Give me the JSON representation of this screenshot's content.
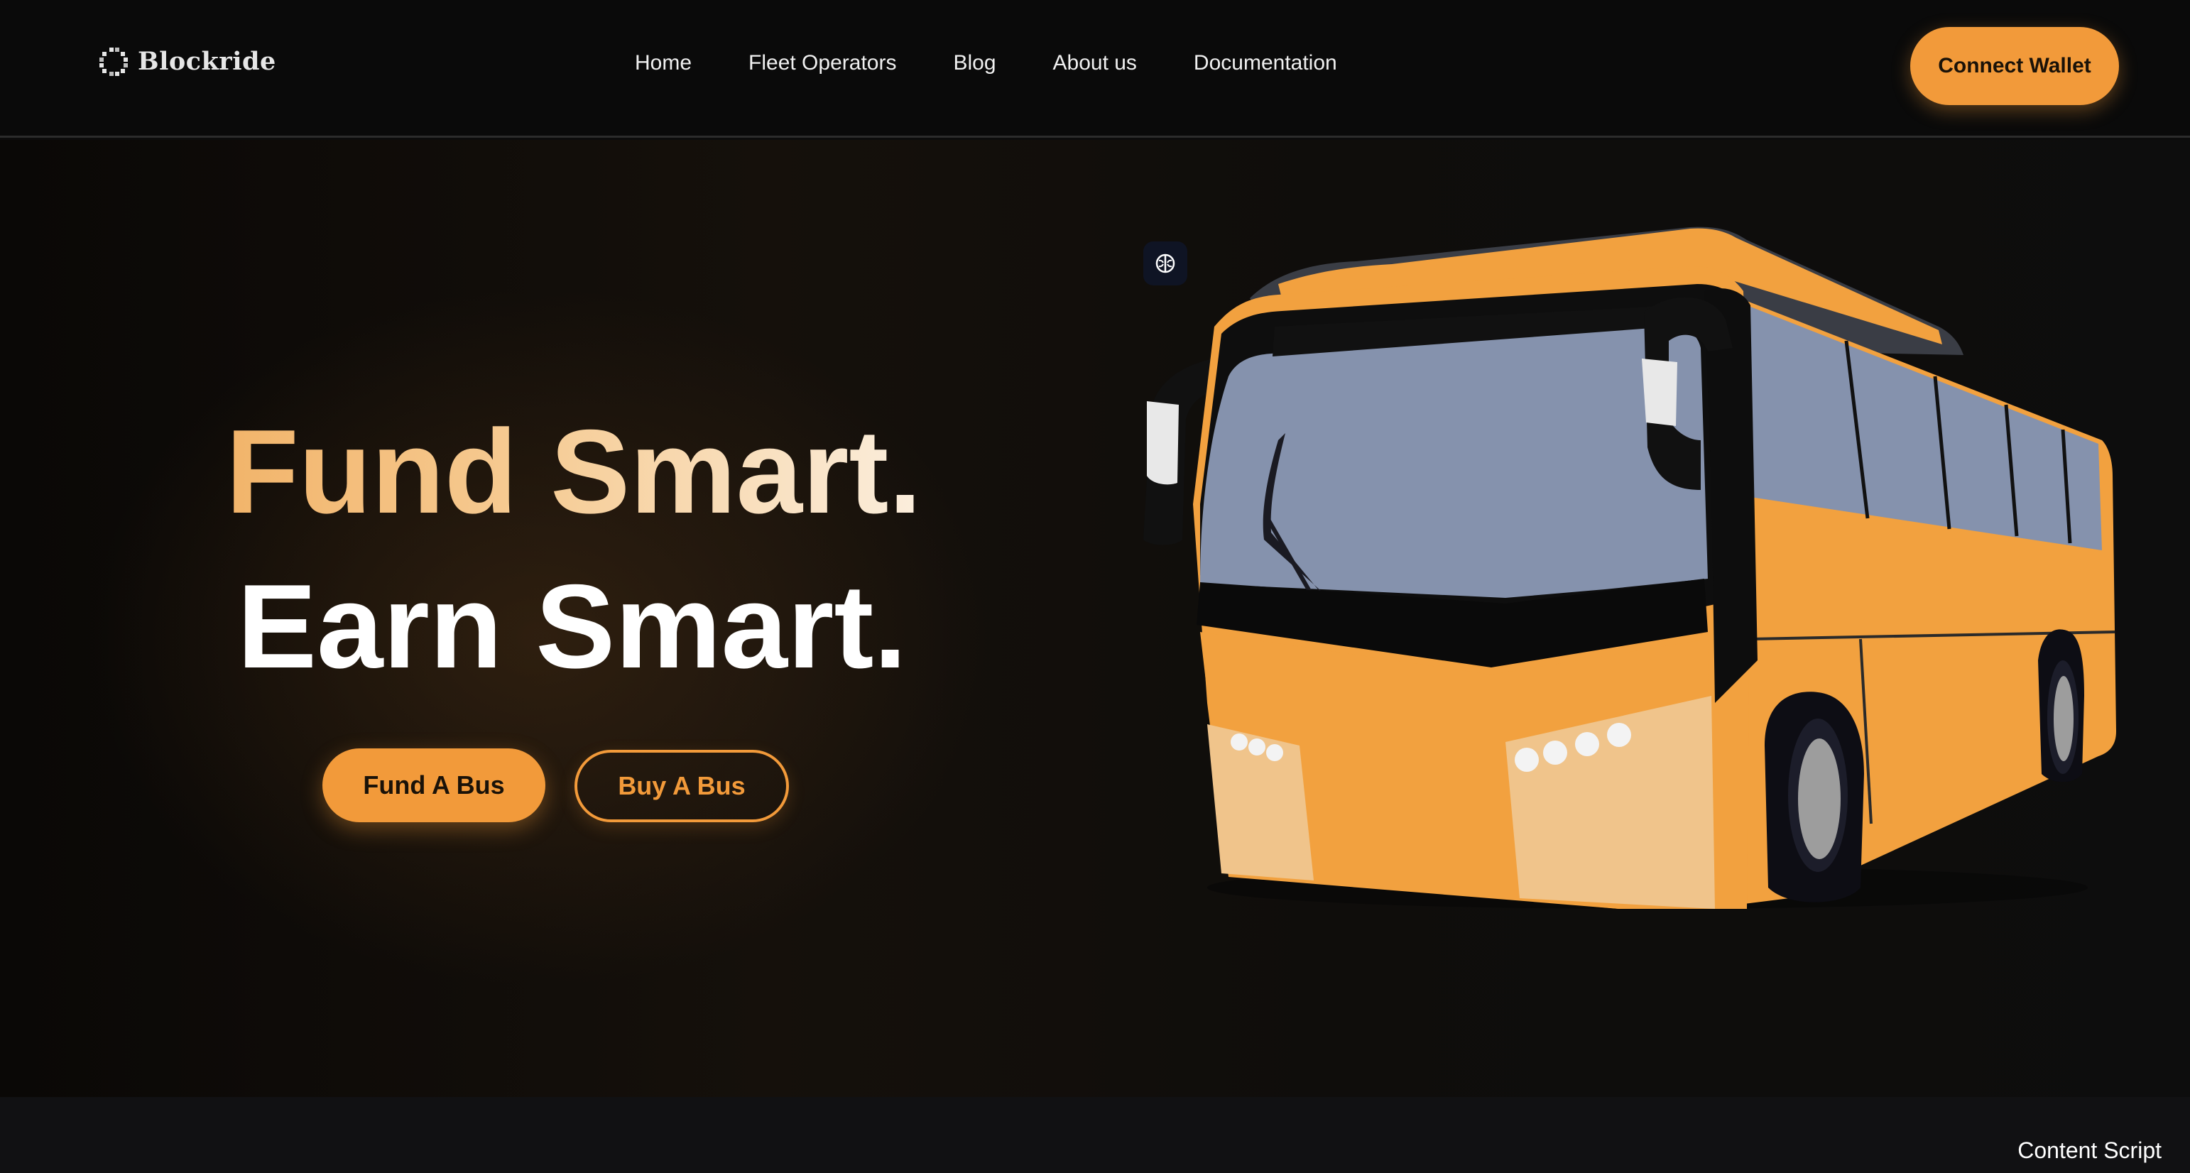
{
  "brand": {
    "name": "Blockride",
    "logo_icon": "block-logo-icon"
  },
  "nav": {
    "items": [
      {
        "label": "Home"
      },
      {
        "label": "Fleet Operators"
      },
      {
        "label": "Blog"
      },
      {
        "label": "About us"
      },
      {
        "label": "Documentation"
      }
    ],
    "connect_label": "Connect Wallet"
  },
  "hero": {
    "headline_1": "Fund Smart.",
    "headline_2": "Earn Smart.",
    "fund_label": "Fund A Bus",
    "buy_label": "Buy A Bus",
    "illustration": "bus-illustration",
    "badge_icon": "brain-icon"
  },
  "footer": {
    "content_script_label": "Content Script"
  },
  "colors": {
    "accent": "#f29a3a",
    "background": "#0c0c0c",
    "bus_body": "#f2a13f",
    "bus_glass": "#8592ad"
  }
}
